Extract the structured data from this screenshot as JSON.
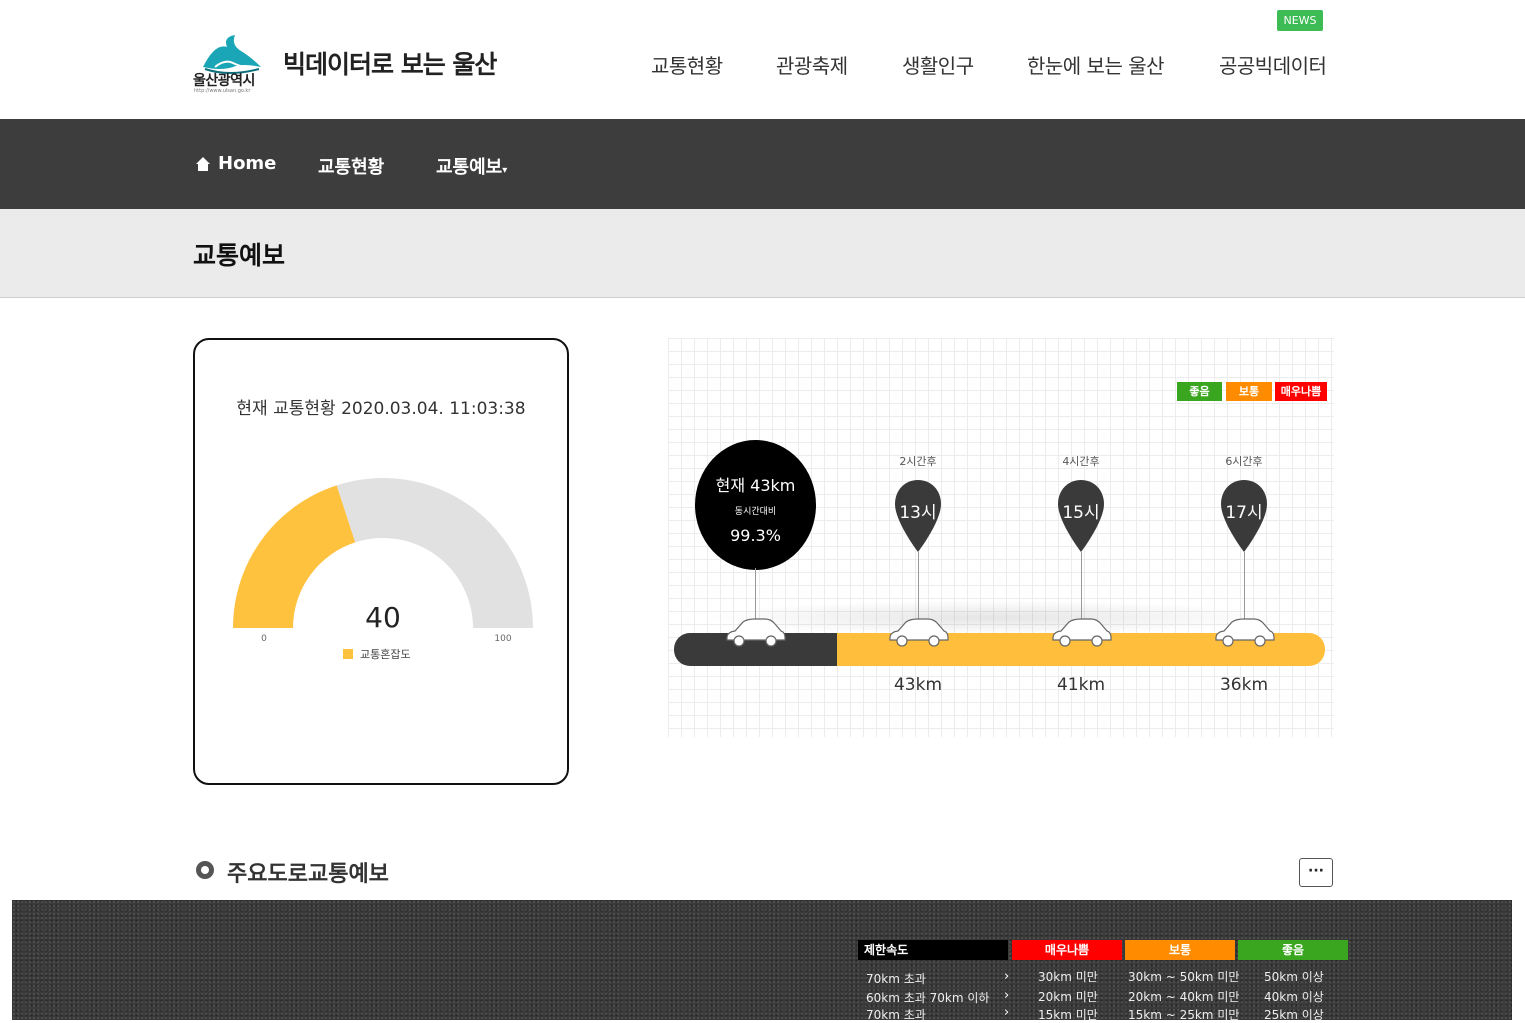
{
  "header": {
    "logo_text": "울산광역시",
    "logo_url": "http://www.ulsan.go.kr",
    "site_title": "빅데이터로 보는 울산",
    "news_badge": "NEWS",
    "top_nav": [
      "교통현황",
      "관광축제",
      "생활인구",
      "한눈에 보는 울산",
      "공공빅데이터"
    ]
  },
  "navbar": {
    "home": "Home",
    "items": [
      "교통현황",
      "교통예보"
    ],
    "dropdown_caret": "▾"
  },
  "page_title": "교통예보",
  "gauge": {
    "header": "현재 교통현황 2020.03.04. 11:03:38",
    "value": 40,
    "min_label": "0",
    "max_label": "100",
    "min": 0,
    "max": 100,
    "legend": "교통혼잡도",
    "fill_color": "#ffc23f",
    "track_color": "#e1e1e1"
  },
  "forecast": {
    "legend": [
      {
        "label": "좋음",
        "color": "#3aa51e"
      },
      {
        "label": "보통",
        "color": "#ff8c00"
      },
      {
        "label": "매우나쁨",
        "color": "#ff0000"
      }
    ],
    "current": {
      "line1": "현재 43km",
      "line2": "동시간대비",
      "line3": "99.3%"
    },
    "points": [
      {
        "after": "2시간후",
        "hour": "13시",
        "speed": "43km"
      },
      {
        "after": "4시간후",
        "hour": "15시",
        "speed": "41km"
      },
      {
        "after": "6시간후",
        "hour": "17시",
        "speed": "36km"
      }
    ]
  },
  "section": {
    "title": "주요도로교통예보",
    "more_button": "···"
  },
  "speed_table": {
    "headers": [
      "제한속도",
      "매우나쁨",
      "보통",
      "좋음"
    ],
    "header_colors": [
      "#000000",
      "#ff0000",
      "#ff8c00",
      "#3aa51e"
    ],
    "rows": [
      [
        "70km 초과",
        "30km 미만",
        "30km ~ 50km 미만",
        "50km 이상"
      ],
      [
        "60km 초과 70km 이하",
        "20km 미만",
        "20km ~ 40km 미만",
        "40km 이상"
      ],
      [
        "70km 초과",
        "15km 미만",
        "15km ~ 25km 미만",
        "25km 이상"
      ]
    ],
    "arrow": "›"
  }
}
